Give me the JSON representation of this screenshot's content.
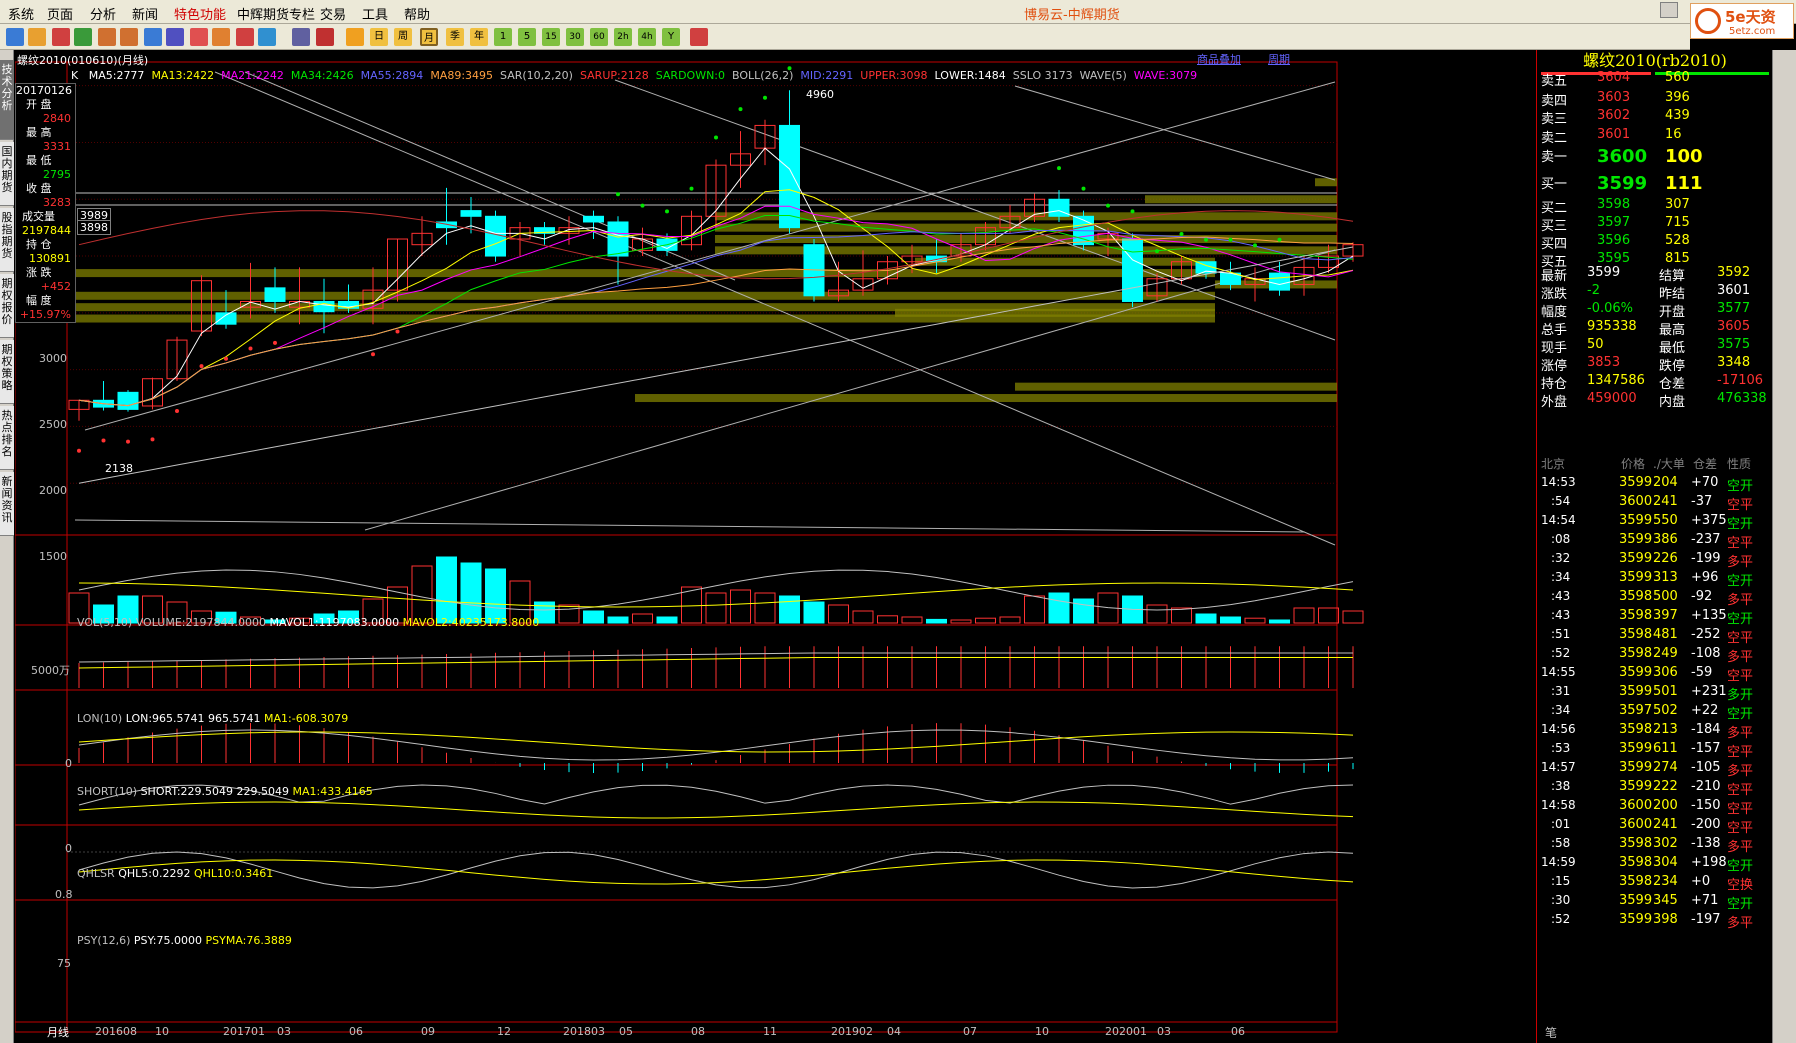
{
  "menu": {
    "items": [
      "系统",
      "页面",
      "分析",
      "新闻",
      "特色功能",
      "中辉期货专栏",
      "交易",
      "工具",
      "帮助"
    ],
    "highlight_index": 4
  },
  "app_title": "博易云-中辉期货",
  "logo": {
    "brand": "5e天资",
    "url": "5etz.com"
  },
  "toolbar": {
    "periods": [
      "日",
      "周",
      "月",
      "季",
      "年",
      "1",
      "5",
      "15",
      "30",
      "60",
      "2h",
      "4h",
      "Y"
    ]
  },
  "sidebar": {
    "tabs": [
      "技术分析",
      "国内期货",
      "股指期货",
      "期权报价",
      "期权策略",
      "热点排名",
      "新闻资讯"
    ]
  },
  "chart_header": {
    "title": "螺纹2010(010610)(月线)",
    "link1": "商品叠加",
    "link2": "周期"
  },
  "indicators": {
    "main": {
      "k": "K",
      "ma5": "MA5:2777",
      "ma13": "MA13:2422",
      "ma21": "MA21:2242",
      "ma34": "MA34:2426",
      "ma55": "MA55:2894",
      "ma89": "MA89:3495",
      "sar": "SAR(10,2,20)",
      "sarup": "SARUP:2128",
      "sardown": "SARDOWN:0",
      "boll": "BOLL(26,2)",
      "mid": "MID:2291",
      "upper": "UPPER:3098",
      "lower": "LOWER:1484",
      "sslo": "SSLO 3173",
      "wave": "WAVE(5)",
      "wave2": "WAVE:3079"
    },
    "vol": {
      "name": "VOL(5,10)",
      "volume": "VOLUME:2197844.0000",
      "mavol1": "MAVOL1:1197083.0000",
      "mavol2": "MAVOL2:40235173.8000"
    },
    "lon": {
      "name": "LON(10)",
      "lon": "LON:965.5741",
      "val": "965.5741",
      "ma1": "MA1:-608.3079"
    },
    "short": {
      "name": "SHORT(10)",
      "short": "SHORT:229.5049",
      "val": "229.5049",
      "ma1": "MA1:433.4165"
    },
    "qhlsr": {
      "name": "QHLSR",
      "qhl5": "QHL5:0.2292",
      "qhl10": "QHL10:0.3461"
    },
    "psy": {
      "name": "PSY(12,6)",
      "psy": "PSY:75.0000",
      "psyma": "PSYMA:76.3889"
    }
  },
  "price_axis": [
    "3000",
    "2500",
    "2000",
    "1500"
  ],
  "sub_axis": {
    "vol": "5000万",
    "lon": "0",
    "short": "0",
    "qhlsr": "0.8",
    "psy": "75"
  },
  "annotations": {
    "high": "4960",
    "low": "2138",
    "h1": "3989",
    "h2": "3898"
  },
  "time_axis": {
    "period": "月线",
    "labels": [
      "201608",
      "10",
      "201701",
      "03",
      "06",
      "09",
      "12",
      "201803",
      "05",
      "08",
      "11",
      "201902",
      "04",
      "07",
      "10",
      "202001",
      "03",
      "06"
    ]
  },
  "info_panel": [
    {
      "label": "20170126",
      "value": ""
    },
    {
      "label": "开  盘",
      "value": "2840"
    },
    {
      "label": "最  高",
      "value": "3331"
    },
    {
      "label": "最  低",
      "value": "2795"
    },
    {
      "label": "收  盘",
      "value": "3283"
    },
    {
      "label": "成交量",
      "value": "2197844"
    },
    {
      "label": "持  仓",
      "value": "130891"
    },
    {
      "label": "涨  跌",
      "value": "+452"
    },
    {
      "label": "幅  度",
      "value": "+15.97%"
    }
  ],
  "quote": {
    "title": "螺纹2010(rb2010)",
    "asks": [
      {
        "label": "卖五",
        "price": "3604",
        "vol": "560"
      },
      {
        "label": "卖四",
        "price": "3603",
        "vol": "396"
      },
      {
        "label": "卖三",
        "price": "3602",
        "vol": "439"
      },
      {
        "label": "卖二",
        "price": "3601",
        "vol": "16"
      },
      {
        "label": "卖一",
        "price": "3600",
        "vol": "100"
      }
    ],
    "bids": [
      {
        "label": "买一",
        "price": "3599",
        "vol": "111"
      },
      {
        "label": "买二",
        "price": "3598",
        "vol": "307"
      },
      {
        "label": "买三",
        "price": "3597",
        "vol": "715"
      },
      {
        "label": "买四",
        "price": "3596",
        "vol": "528"
      },
      {
        "label": "买五",
        "price": "3595",
        "vol": "815"
      }
    ],
    "stats": [
      {
        "l1": "最新",
        "v1": "3599",
        "l2": "结算",
        "v2": "3592"
      },
      {
        "l1": "涨跌",
        "v1": "-2",
        "l2": "昨结",
        "v2": "3601"
      },
      {
        "l1": "幅度",
        "v1": "-0.06%",
        "l2": "开盘",
        "v2": "3577"
      },
      {
        "l1": "总手",
        "v1": "935338",
        "l2": "最高",
        "v2": "3605"
      },
      {
        "l1": "现手",
        "v1": "50",
        "l2": "最低",
        "v2": "3575"
      },
      {
        "l1": "涨停",
        "v1": "3853",
        "l2": "跌停",
        "v2": "3348"
      },
      {
        "l1": "持仓",
        "v1": "1347586",
        "l2": "仓差",
        "v2": "-17106"
      },
      {
        "l1": "外盘",
        "v1": "459000",
        "l2": "内盘",
        "v2": "476338"
      }
    ],
    "tick_headers": [
      "北京",
      "价格",
      "./大单",
      "仓差",
      "性质"
    ],
    "ticks": [
      {
        "t": "14:53",
        "p": "3599",
        "v": "204",
        "d": "+70",
        "n": "空开"
      },
      {
        "t": ":54",
        "p": "3600",
        "v": "241",
        "d": "-37",
        "n": "空平"
      },
      {
        "t": "14:54",
        "p": "3599",
        "v": "550",
        "d": "+375",
        "n": "空开"
      },
      {
        "t": ":08",
        "p": "3599",
        "v": "386",
        "d": "-237",
        "n": "空平"
      },
      {
        "t": ":32",
        "p": "3599",
        "v": "226",
        "d": "-199",
        "n": "多平"
      },
      {
        "t": ":34",
        "p": "3599",
        "v": "313",
        "d": "+96",
        "n": "空开"
      },
      {
        "t": ":43",
        "p": "3598",
        "v": "500",
        "d": "-92",
        "n": "多平"
      },
      {
        "t": ":43",
        "p": "3598",
        "v": "397",
        "d": "+135",
        "n": "空开"
      },
      {
        "t": ":51",
        "p": "3598",
        "v": "481",
        "d": "-252",
        "n": "空平"
      },
      {
        "t": ":52",
        "p": "3598",
        "v": "249",
        "d": "-108",
        "n": "多平"
      },
      {
        "t": "14:55",
        "p": "3599",
        "v": "306",
        "d": "-59",
        "n": "空平"
      },
      {
        "t": ":31",
        "p": "3599",
        "v": "501",
        "d": "+231",
        "n": "多开"
      },
      {
        "t": ":34",
        "p": "3597",
        "v": "502",
        "d": "+22",
        "n": "空开"
      },
      {
        "t": "14:56",
        "p": "3598",
        "v": "213",
        "d": "-184",
        "n": "多平"
      },
      {
        "t": ":53",
        "p": "3599",
        "v": "611",
        "d": "-157",
        "n": "空平"
      },
      {
        "t": "14:57",
        "p": "3599",
        "v": "274",
        "d": "-105",
        "n": "多平"
      },
      {
        "t": ":38",
        "p": "3599",
        "v": "222",
        "d": "-210",
        "n": "空平"
      },
      {
        "t": "14:58",
        "p": "3600",
        "v": "200",
        "d": "-150",
        "n": "空平"
      },
      {
        "t": ":01",
        "p": "3600",
        "v": "241",
        "d": "-200",
        "n": "空平"
      },
      {
        "t": ":58",
        "p": "3598",
        "v": "302",
        "d": "-138",
        "n": "多平"
      },
      {
        "t": "14:59",
        "p": "3598",
        "v": "304",
        "d": "+198",
        "n": "空开"
      },
      {
        "t": ":15",
        "p": "3598",
        "v": "234",
        "d": "+0",
        "n": "空换"
      },
      {
        "t": ":30",
        "p": "3599",
        "v": "345",
        "d": "+71",
        "n": "空开"
      },
      {
        "t": ":52",
        "p": "3599",
        "v": "398",
        "d": "-197",
        "n": "多平"
      }
    ],
    "bottom_tab": "笔"
  },
  "candles": [
    [
      2150,
      2230,
      2050,
      2235
    ],
    [
      2230,
      2170,
      2140,
      2400
    ],
    [
      2300,
      2150,
      2130,
      2320
    ],
    [
      2180,
      2420,
      2150,
      2430
    ],
    [
      2420,
      2760,
      2400,
      2790
    ],
    [
      2840,
      3283,
      2795,
      3331
    ],
    [
      3000,
      2900,
      2860,
      3200
    ],
    [
      3050,
      3100,
      2950,
      3440
    ],
    [
      3220,
      3100,
      3000,
      3400
    ],
    [
      3050,
      3100,
      2900,
      3400
    ],
    [
      3100,
      3010,
      2820,
      3300
    ],
    [
      3100,
      3040,
      3000,
      3250
    ],
    [
      3040,
      3200,
      2900,
      3400
    ],
    [
      3200,
      3650,
      3100,
      3650
    ],
    [
      3600,
      3700,
      3500,
      3850
    ],
    [
      3800,
      3750,
      3600,
      4100
    ],
    [
      3900,
      3850,
      3700,
      4020
    ],
    [
      3850,
      3500,
      3450,
      3900
    ],
    [
      3650,
      3750,
      3500,
      3800
    ],
    [
      3750,
      3700,
      3600,
      3800
    ],
    [
      3700,
      3750,
      3600,
      3850
    ],
    [
      3850,
      3800,
      3650,
      3900
    ],
    [
      3800,
      3500,
      3250,
      3850
    ],
    [
      3550,
      3650,
      3500,
      3750
    ],
    [
      3650,
      3550,
      3500,
      3700
    ],
    [
      3600,
      3850,
      3550,
      3900
    ],
    [
      3850,
      4300,
      3750,
      4350
    ],
    [
      4300,
      4400,
      4100,
      4600
    ],
    [
      4450,
      4650,
      4300,
      4700
    ],
    [
      4650,
      3750,
      3700,
      4960
    ],
    [
      3600,
      3150,
      3100,
      3650
    ],
    [
      3150,
      3200,
      3100,
      3450
    ],
    [
      3200,
      3300,
      3150,
      3550
    ],
    [
      3300,
      3450,
      3250,
      3500
    ],
    [
      3450,
      3500,
      3350,
      3600
    ],
    [
      3500,
      3450,
      3350,
      3650
    ],
    [
      3500,
      3600,
      3450,
      3700
    ],
    [
      3600,
      3750,
      3550,
      3800
    ],
    [
      3750,
      3850,
      3700,
      3950
    ],
    [
      3850,
      4000,
      3800,
      4050
    ],
    [
      4000,
      3850,
      3800,
      4080
    ],
    [
      3850,
      3600,
      3550,
      3900
    ],
    [
      3650,
      3700,
      3500,
      3750
    ],
    [
      3650,
      3100,
      3050,
      3700
    ],
    [
      3150,
      3300,
      3100,
      3350
    ],
    [
      3300,
      3450,
      3250,
      3500
    ],
    [
      3450,
      3350,
      3300,
      3450
    ],
    [
      3350,
      3250,
      3200,
      3450
    ],
    [
      3250,
      3300,
      3100,
      3400
    ],
    [
      3350,
      3200,
      3150,
      3450
    ],
    [
      3250,
      3400,
      3150,
      3500
    ],
    [
      3400,
      3500,
      3350,
      3600
    ],
    [
      3500,
      3600,
      3450,
      3620
    ]
  ],
  "volumes": [
    0,
    0,
    0,
    0,
    0,
    0,
    0,
    0,
    0,
    0,
    0,
    0,
    0,
    0,
    0,
    0,
    0,
    0,
    0,
    0,
    0,
    0,
    0,
    0,
    0,
    0,
    0,
    0,
    0,
    0,
    0,
    0,
    0,
    0,
    0,
    0,
    0,
    0,
    0,
    0,
    0,
    0,
    0,
    0,
    0,
    0,
    0,
    0,
    0,
    0,
    0,
    0,
    0
  ],
  "colors": {
    "up": "#ff3232",
    "down": "#00ffff",
    "grid": "#c00000",
    "yellow": "#ffff00",
    "gray": "#c0c0c0",
    "band": "#808000"
  }
}
